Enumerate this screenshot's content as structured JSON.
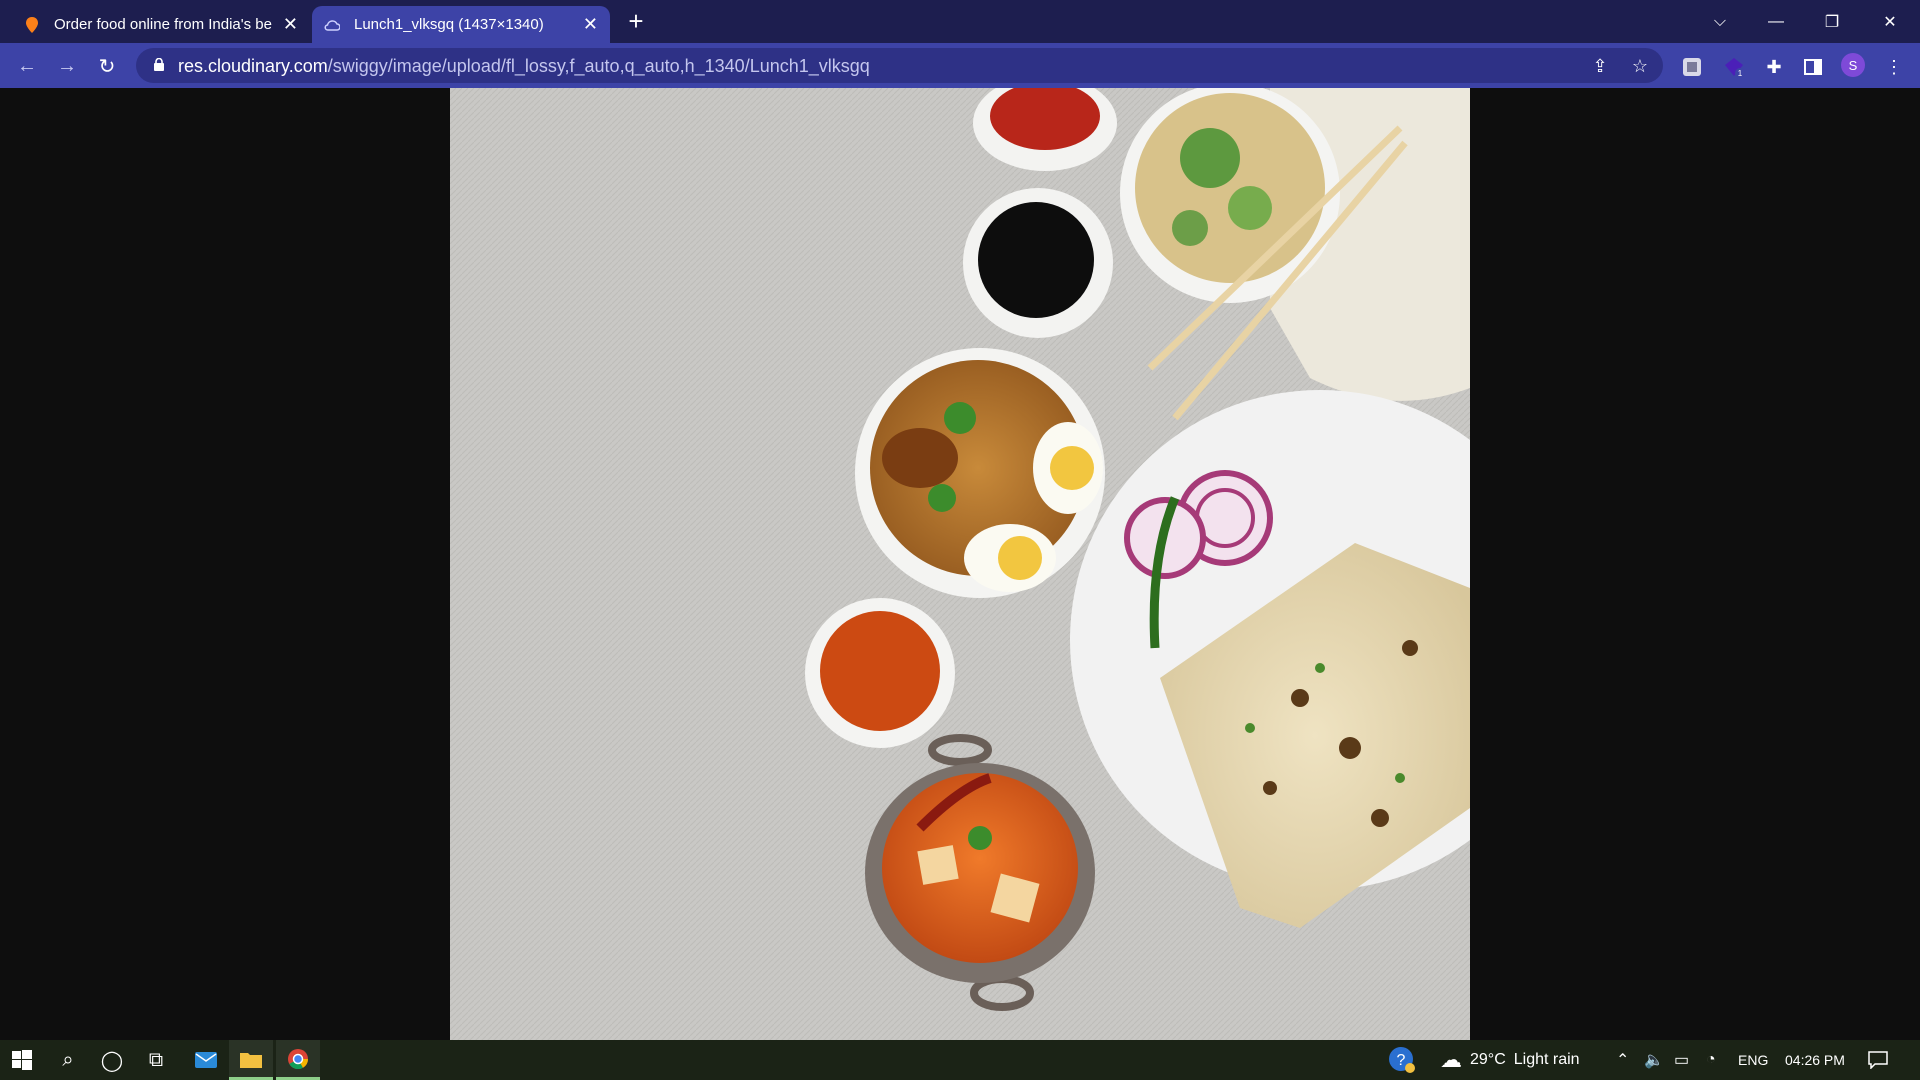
{
  "browser": {
    "tabs": [
      {
        "title": "Order food online from India's be",
        "favicon": "swiggy-pin-icon",
        "active": false
      },
      {
        "title": "Lunch1_vlksgq (1437×1340)",
        "favicon": "cloudinary-cloud-icon",
        "active": true
      }
    ],
    "address": {
      "host": "res.cloudinary.com",
      "path": "/swiggy/image/upload/fl_lossy,f_auto,q_auto,h_1340/Lunch1_vlksgq"
    },
    "profile_initial": "S",
    "extension_badge": "1"
  },
  "taskbar": {
    "weather_temp": "29°C",
    "weather_desc": "Light rain",
    "language": "ENG",
    "time": "04:26 PM"
  },
  "colors": {
    "tabbar_bg": "#1d1e4f",
    "toolbar_bg": "#3d43a7",
    "omnibox_bg": "#2e3186",
    "viewer_bg": "#0e0e0e",
    "taskbar_bg": "#1b2316"
  }
}
